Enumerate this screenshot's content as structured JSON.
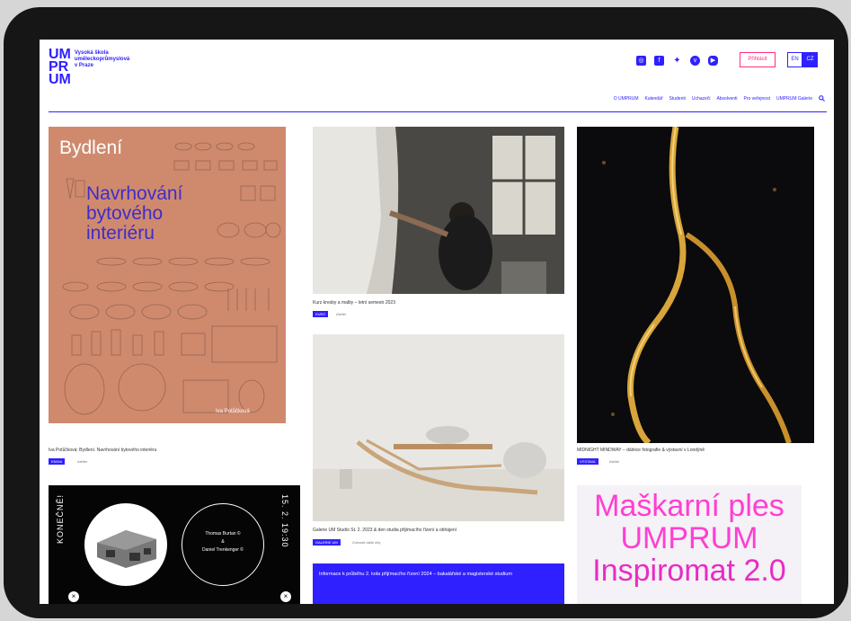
{
  "logo": {
    "mark_line1": "UM",
    "mark_line2": "PR",
    "mark_line3": "UM",
    "text_line1": "Vysoká škola",
    "text_line2": "uměleckoprůmyslová",
    "text_line3": "v Praze"
  },
  "header": {
    "social_icons": [
      "instagram-icon",
      "facebook-icon",
      "twitter-icon",
      "vimeo-icon",
      "youtube-icon"
    ],
    "login_label": "Přihlásit",
    "lang_en": "EN",
    "lang_cz": "CZ",
    "nav": [
      "O UMPRUM",
      "Kalendář",
      "Studenti",
      "Uchazeči",
      "Absolventi",
      "Pro veřejnost",
      "UMPRUM Galerie"
    ]
  },
  "cards": {
    "bydleni": {
      "poster_title": "Bydlení",
      "poster_line1": "Navrhování",
      "poster_line2": "bytového",
      "poster_line3": "interiéru",
      "poster_author": "Iva Potůčková",
      "caption": "Iva Potůčková: Bydlení. Navrhování bytového interiéru",
      "tag": "KNIHA",
      "meta": "Ateliér"
    },
    "kurz": {
      "caption": "Kurz kresby a malby – letní semestr 2023",
      "tag": "KURZ",
      "meta": "Ateliér"
    },
    "midnight": {
      "caption": "MIDNIGHT MINDWAY – dálnice fotografie & výstavní v Londýně",
      "tag": "VÝSTAVA",
      "meta": "Ateliér"
    },
    "galerie": {
      "caption": "Galerie UM Studio St. 2. 2023 & den studia přijímacího řízení a obhájení",
      "tag": "GALERIE UM",
      "meta": "Zobrazit další díly"
    },
    "konecne": {
      "vertical_left": "KONEČNĚ!",
      "vertical_right": "15. 2. 19:30",
      "circle_line1": "Thomas Burtan ©",
      "circle_line2": "&",
      "circle_line3": "Daniel Trenkenger ©",
      "close_symbol": "×"
    },
    "banner": {
      "text": "Informace k průběhu 2. kola přijímacího řízení 2024 – bakalářské a magisterské studium"
    },
    "maskarni": {
      "line1": "Maškarní ples",
      "line2": "UMPRUM",
      "line3": "Inspiromat 2.0"
    }
  }
}
